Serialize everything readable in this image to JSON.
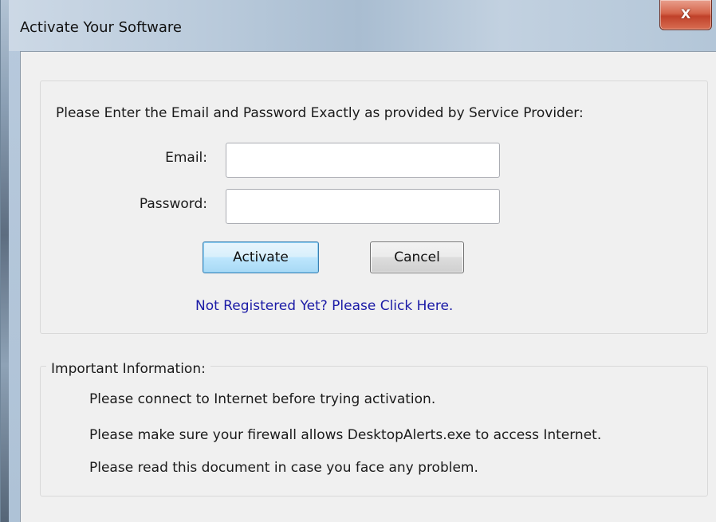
{
  "window": {
    "title": "Activate Your Software",
    "close_glyph": "X"
  },
  "form": {
    "instructions": "Please Enter the Email and Password Exactly as provided by Service Provider:",
    "email_label": "Email:",
    "email_value": "",
    "password_label": "Password:",
    "password_value": "",
    "activate_label": "Activate",
    "cancel_label": "Cancel",
    "register_link": "Not Registered Yet? Please Click Here."
  },
  "info": {
    "group_label": "Important Information:",
    "line1": "Please connect to Internet before trying activation.",
    "line2": "Please make sure your firewall allows DesktopAlerts.exe to access Internet.",
    "line3": "Please read this document in case you face any problem."
  },
  "colors": {
    "link": "#1a1aa6",
    "close_button": "#c8452e",
    "activate_border": "#3c7fb1"
  }
}
